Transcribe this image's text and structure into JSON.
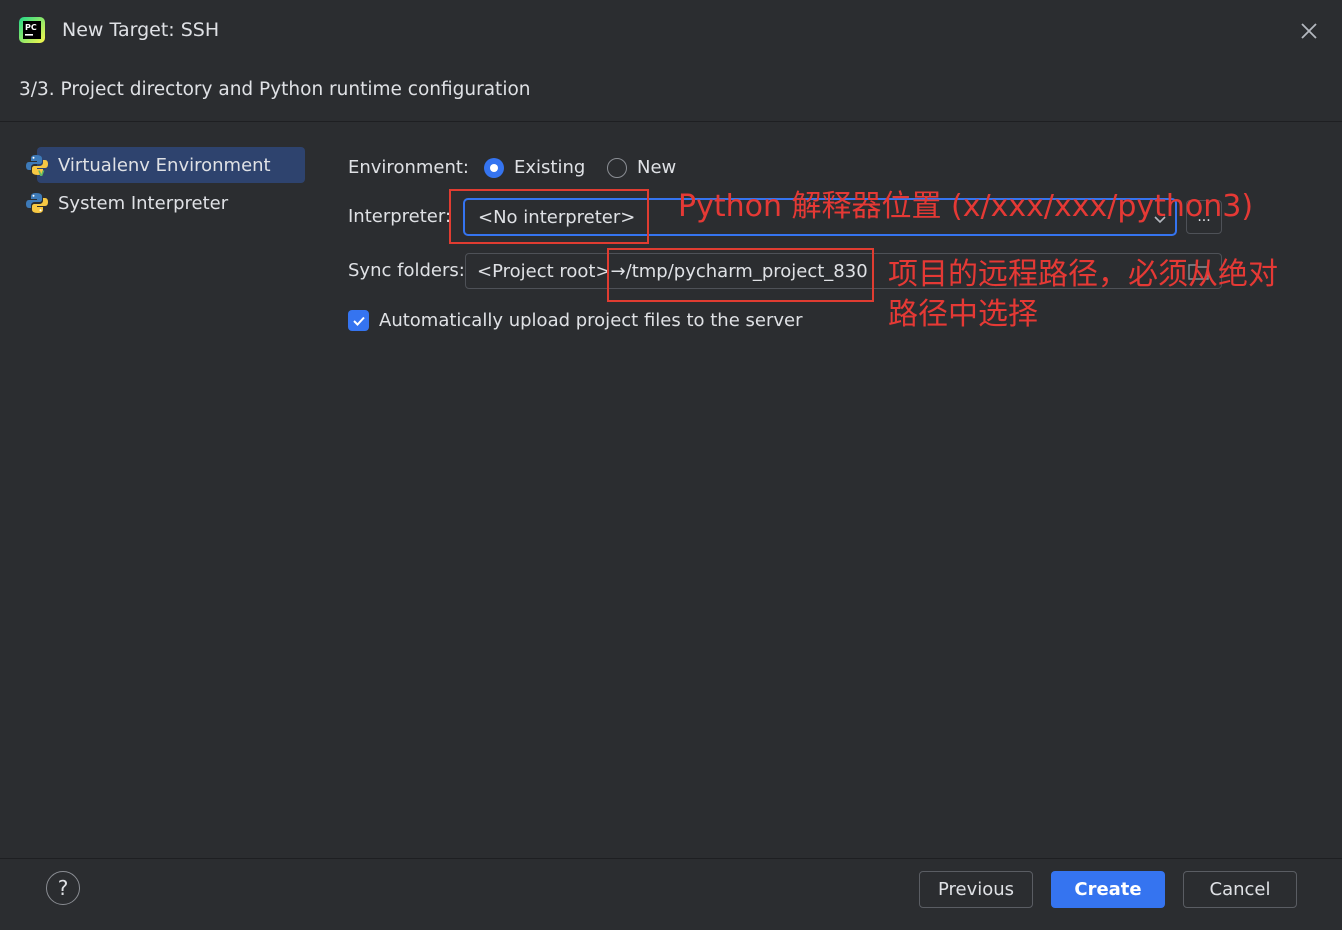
{
  "window": {
    "title": "New Target: SSH",
    "step": "3/3. Project directory and Python runtime configuration"
  },
  "sidebar": {
    "items": [
      {
        "label": "Virtualenv Environment",
        "icon": "python-venv-icon",
        "selected": true
      },
      {
        "label": "System Interpreter",
        "icon": "python-icon",
        "selected": false
      }
    ]
  },
  "form": {
    "environment": {
      "label": "Environment:",
      "options": [
        "Existing",
        "New"
      ],
      "selected": "Existing"
    },
    "interpreter": {
      "label": "Interpreter:",
      "value": "<No interpreter>",
      "browse": "..."
    },
    "sync": {
      "label": "Sync folders:",
      "value": "<Project root>→/tmp/pycharm_project_830"
    },
    "auto_upload": {
      "label": "Automatically upload project files to the server",
      "checked": true
    }
  },
  "annotations": {
    "interpreter_note": "Python 解释器位置 (x/xxx/xxx/python3)",
    "sync_note_line1": "项目的远程路径，必须从绝对",
    "sync_note_line2": "路径中选择"
  },
  "footer": {
    "help": "?",
    "previous": "Previous",
    "create": "Create",
    "cancel": "Cancel"
  },
  "colors": {
    "background": "#2b2d30",
    "accent": "#3574f0",
    "selection": "#2e436e",
    "annotation": "#e53935"
  }
}
